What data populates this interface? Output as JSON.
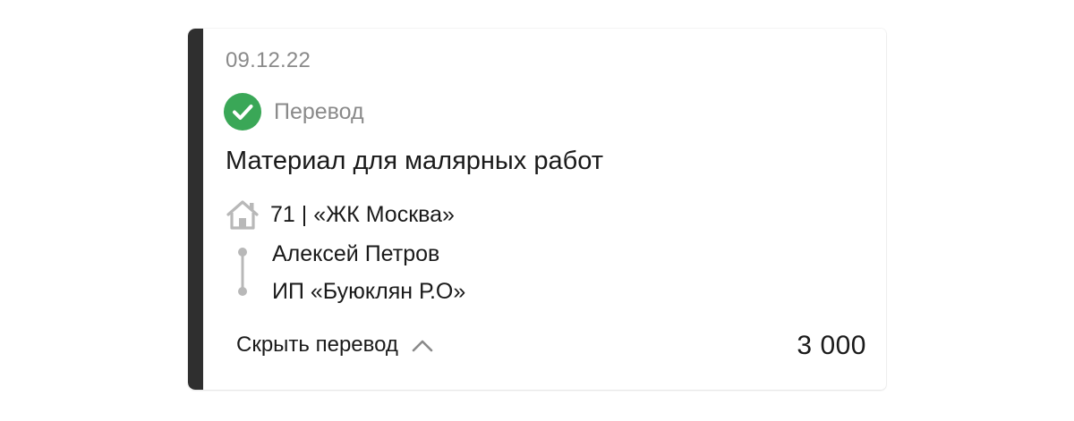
{
  "transaction": {
    "date": "09.12.22",
    "status_label": "Перевод",
    "title": "Материал для малярных работ",
    "object_label": "71 | «ЖК Москва»",
    "from": "Алексей Петров",
    "to": "ИП «Буюклян Р.О»",
    "toggle_label": "Скрыть перевод",
    "amount": "3 000"
  },
  "icons": {
    "status": "check-circle-icon",
    "object": "house-icon",
    "route": "route-line-icon",
    "toggle": "chevron-up-icon"
  },
  "colors": {
    "accent_bar": "#2f2f2f",
    "success": "#3aa757",
    "muted_text": "#8a8a8a",
    "primary_text": "#1a1a1a",
    "icon_gray": "#b8b8b8"
  }
}
